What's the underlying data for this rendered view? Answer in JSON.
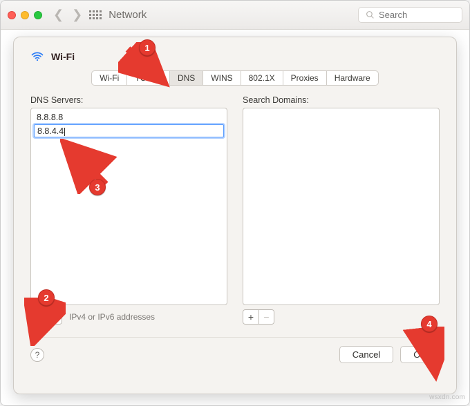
{
  "toolbar": {
    "title": "Network",
    "search_placeholder": "Search"
  },
  "sheet": {
    "heading": "Wi-Fi",
    "tabs": [
      "Wi-Fi",
      "TCP/IP",
      "DNS",
      "WINS",
      "802.1X",
      "Proxies",
      "Hardware"
    ],
    "tabs_active": "DNS",
    "dns_label": "DNS Servers:",
    "search_domains_label": "Search Domains:",
    "dns_rows": [
      "8.8.8.8",
      "8.8.4.4"
    ],
    "dns_editing_index": 1,
    "hint": "IPv4 or IPv6 addresses",
    "plus": "+",
    "minus": "−",
    "help": "?",
    "cancel": "Cancel",
    "ok": "OK"
  },
  "annotations": {
    "1": "1",
    "2": "2",
    "3": "3",
    "4": "4"
  },
  "watermark": "wsxdn.com"
}
